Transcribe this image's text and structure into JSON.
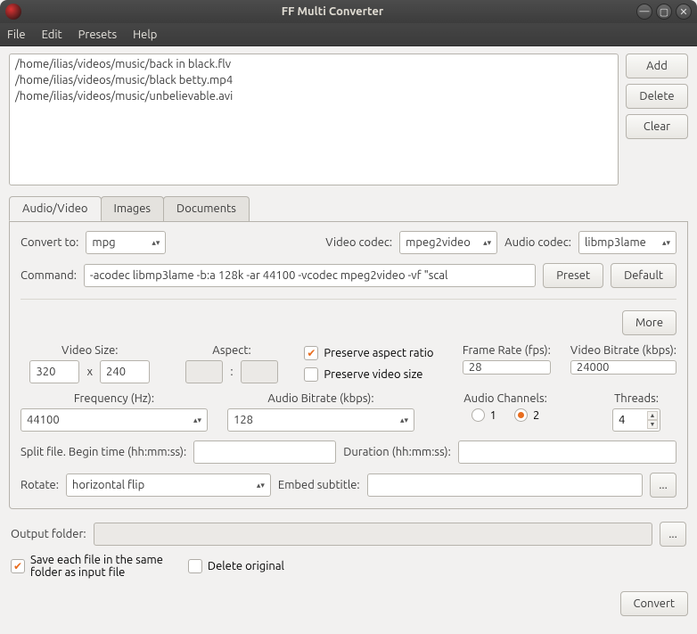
{
  "titlebar": {
    "title": "FF Multi Converter"
  },
  "menubar": {
    "file": "File",
    "edit": "Edit",
    "presets": "Presets",
    "help": "Help"
  },
  "winbtns": {
    "min": "—",
    "max": "▢",
    "close": "✕"
  },
  "filelist": {
    "items": [
      "/home/ilias/videos/music/back in black.flv",
      "/home/ilias/videos/music/black betty.mp4",
      "/home/ilias/videos/music/unbelievable.avi"
    ]
  },
  "sidebtns": {
    "add": "Add",
    "delete": "Delete",
    "clear": "Clear"
  },
  "tabs": {
    "audiovideo": "Audio/Video",
    "images": "Images",
    "documents": "Documents"
  },
  "av": {
    "convert_to_label": "Convert to:",
    "convert_to_value": "mpg",
    "video_codec_label": "Video codec:",
    "video_codec_value": "mpeg2video",
    "audio_codec_label": "Audio codec:",
    "audio_codec_value": "libmp3lame",
    "command_label": "Command:",
    "command_value": "-acodec libmp3lame -b:a 128k -ar 44100 -vcodec mpeg2video -vf \"scal",
    "preset_btn": "Preset",
    "default_btn": "Default",
    "more_btn": "More",
    "video_size_label": "Video Size:",
    "video_w": "320",
    "video_x": "x",
    "video_h": "240",
    "aspect_label": "Aspect:",
    "aspect_colon": ":",
    "preserve_aspect": "Preserve aspect ratio",
    "preserve_size": "Preserve video size",
    "frame_rate_label": "Frame Rate (fps):",
    "frame_rate": "28",
    "video_bitrate_label": "Video Bitrate (kbps):",
    "video_bitrate": "24000",
    "freq_label": "Frequency (Hz):",
    "freq": "44100",
    "audio_bitrate_label": "Audio Bitrate (kbps):",
    "audio_bitrate": "128",
    "audio_channels_label": "Audio Channels:",
    "ch1": "1",
    "ch2": "2",
    "threads_label": "Threads:",
    "threads": "4",
    "split_label": "Split file. Begin time (hh:mm:ss):",
    "duration_label": "Duration (hh:mm:ss):",
    "rotate_label": "Rotate:",
    "rotate_value": "horizontal flip",
    "subtitle_label": "Embed subtitle:",
    "browse": "..."
  },
  "output": {
    "folder_label": "Output folder:",
    "browse": "...",
    "save_same": "Save each file in the same\nfolder as input file",
    "delete_original": "Delete original"
  },
  "convert_btn": "Convert"
}
